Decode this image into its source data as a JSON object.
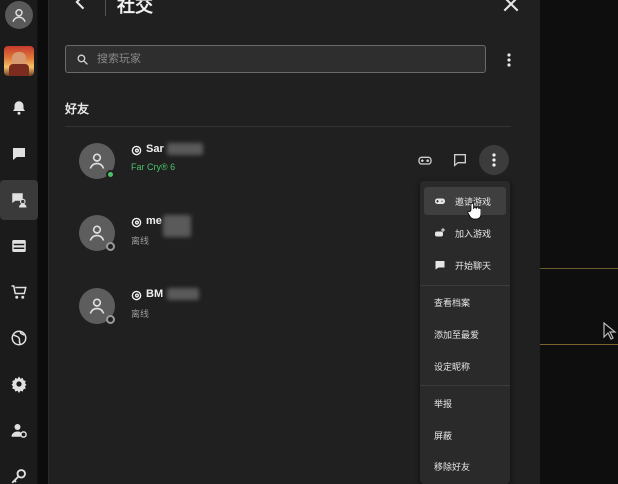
{
  "header": {
    "title": "社交"
  },
  "search": {
    "placeholder": "搜索玩家"
  },
  "friends_section": {
    "title": "好友"
  },
  "friends": [
    {
      "name": "Sar",
      "status": "Far Cry® 6",
      "presence": "online"
    },
    {
      "name": "me",
      "status": "离线",
      "presence": "offline"
    },
    {
      "name": "BM",
      "status": "离线",
      "presence": "offline"
    }
  ],
  "context_menu": {
    "items": [
      {
        "label": "邀请游戏",
        "icon": "gamepad-icon"
      },
      {
        "label": "加入游戏",
        "icon": "join-game-icon"
      },
      {
        "label": "开始聊天",
        "icon": "chat-bubble-icon"
      },
      {
        "label": "查看档案"
      },
      {
        "label": "添加至最爱"
      },
      {
        "label": "设定昵称"
      },
      {
        "label": "举报"
      },
      {
        "label": "屏蔽"
      },
      {
        "label": "移除好友"
      }
    ]
  },
  "sidebar": {
    "items": [
      {
        "icon": "profile-icon"
      },
      {
        "icon": "game-thumbnail"
      },
      {
        "icon": "bell-icon"
      },
      {
        "icon": "chat-icon"
      },
      {
        "icon": "social-icon",
        "active": true
      },
      {
        "icon": "library-icon"
      },
      {
        "icon": "store-cart-icon"
      },
      {
        "icon": "globe-icon"
      },
      {
        "icon": "settings-gear-icon"
      },
      {
        "icon": "account-settings-icon"
      },
      {
        "icon": "key-icon"
      }
    ]
  },
  "colors": {
    "online": "#4cc16b",
    "panel_bg": "#202020",
    "rail_bg": "#1b1b1b",
    "menu_bg": "#2a2a2a"
  }
}
